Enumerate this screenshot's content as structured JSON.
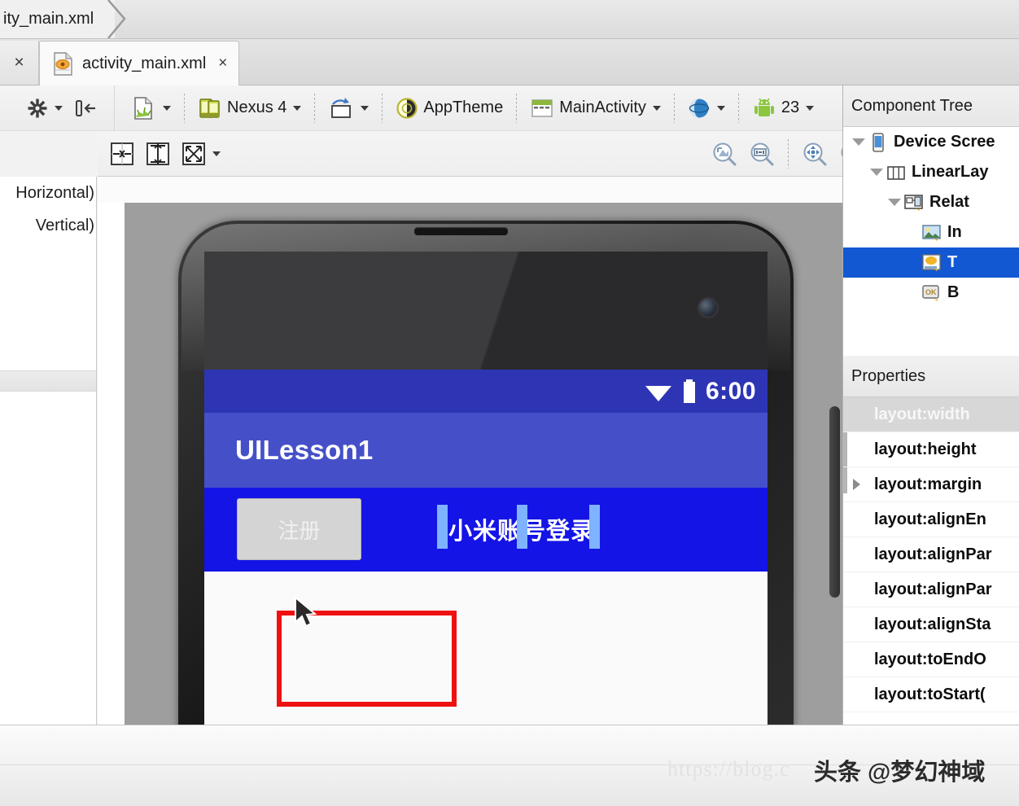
{
  "breadcrumb": {
    "text": "ity_main.xml"
  },
  "editor_tab": {
    "close_left": "×",
    "label": "activity_main.xml",
    "close": "×",
    "icon": "xml-file-icon"
  },
  "toolbar_main": {
    "gear_label": "",
    "items": [
      {
        "name": "settings-gear",
        "label": "",
        "caret": true
      },
      {
        "name": "collapse-panel",
        "label": "",
        "caret": false
      },
      {
        "name": "layout-variant",
        "label": "",
        "caret": true
      },
      {
        "name": "device-selector",
        "label": "Nexus 4",
        "caret": true
      },
      {
        "name": "orientation-selector",
        "label": "",
        "caret": true
      },
      {
        "name": "theme-selector",
        "label": "AppTheme",
        "caret": false
      },
      {
        "name": "activity-selector",
        "label": "MainActivity",
        "caret": true
      },
      {
        "name": "locale-selector",
        "label": "",
        "caret": true
      },
      {
        "name": "api-level-selector",
        "label": "23",
        "caret": true
      }
    ]
  },
  "toolbar_secondary": {
    "left_icons": [
      {
        "name": "align-horizontal-center-button"
      },
      {
        "name": "align-vertical-center-button"
      },
      {
        "name": "expand-all-button",
        "caret": true
      }
    ],
    "right_icons": [
      {
        "name": "zoom-to-fit-button"
      },
      {
        "name": "zoom-actual-size-button"
      },
      {
        "name": "zoom-in-button"
      },
      {
        "name": "zoom-out-button"
      },
      {
        "name": "show-file-button"
      },
      {
        "name": "refresh-button"
      },
      {
        "name": "preview-settings-gear-button"
      }
    ]
  },
  "palette": {
    "items": [
      {
        "label": "Horizontal)"
      },
      {
        "label": "Vertical)"
      }
    ]
  },
  "preview": {
    "app": {
      "status_time": "6:00",
      "wifi_icon": "wifi-icon",
      "battery_icon": "battery-icon",
      "title": "UILesson1",
      "button_label": "注册",
      "textview_label": "小米账号登录"
    },
    "device_name": "Nexus 4"
  },
  "component_tree": {
    "header": "Component Tree",
    "nodes": [
      {
        "label": "Device Scree",
        "icon": "device-screen-icon",
        "depth": 0,
        "expanded": true,
        "selected": false
      },
      {
        "label": "LinearLay",
        "icon": "linearlayout-icon",
        "depth": 1,
        "expanded": true,
        "selected": false
      },
      {
        "label": "Relat",
        "icon": "relativelayout-icon",
        "depth": 2,
        "expanded": true,
        "selected": false
      },
      {
        "label": "In",
        "icon": "imageview-icon",
        "depth": 3,
        "expanded": false,
        "selected": false
      },
      {
        "label": "T",
        "icon": "textview-icon",
        "depth": 3,
        "expanded": false,
        "selected": true
      },
      {
        "label": "B",
        "icon": "button-icon",
        "depth": 3,
        "expanded": false,
        "selected": false
      }
    ]
  },
  "properties": {
    "header": "Properties",
    "rows": [
      {
        "label": "layout:width",
        "active": true,
        "expandable": false
      },
      {
        "label": "layout:height",
        "active": false,
        "expandable": false
      },
      {
        "label": "layout:margin",
        "active": false,
        "expandable": true
      },
      {
        "label": "layout:alignEn",
        "active": false,
        "expandable": false
      },
      {
        "label": "layout:alignPar",
        "active": false,
        "expandable": false
      },
      {
        "label": "layout:alignPar",
        "active": false,
        "expandable": false
      },
      {
        "label": "layout:alignSta",
        "active": false,
        "expandable": false
      },
      {
        "label": "layout:toEndO",
        "active": false,
        "expandable": false
      },
      {
        "label": "layout:toStart(",
        "active": false,
        "expandable": false
      }
    ]
  },
  "watermark": {
    "url": "https://blog.c",
    "brand": "头条 @梦幻神域"
  },
  "colors": {
    "selection_blue": "#1258d3",
    "android_action_bar": "#4550c8",
    "android_status_bar": "#2e35b5",
    "relative_layout_blue": "#1414e6",
    "annotation_red": "#ee1111"
  }
}
